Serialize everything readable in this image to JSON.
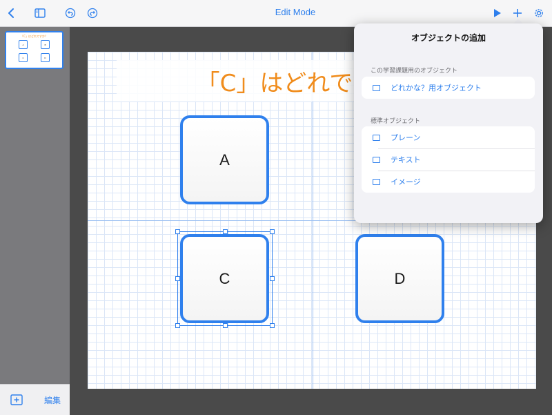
{
  "toolbar": {
    "title": "Edit Mode",
    "icons": [
      "chevron-left-icon",
      "sidebar-toggle-icon",
      "undo-icon",
      "redo-icon",
      "play-icon",
      "plus-icon",
      "gear-icon"
    ]
  },
  "sidebar": {
    "thumbnail": {
      "title": "「C」はどれですか？",
      "labels": [
        "A",
        "B",
        "C",
        "D"
      ]
    },
    "edit_label": "編集"
  },
  "canvas": {
    "title": "「C」はどれですか？",
    "cards": [
      {
        "label": "A"
      },
      {
        "label": "C"
      },
      {
        "label": "D"
      }
    ]
  },
  "popover": {
    "title": "オブジェクトの追加",
    "sections": [
      {
        "header": "この学習課題用のオブジェクト",
        "items": [
          {
            "label": "どれかな？用オブジェクト"
          }
        ]
      },
      {
        "header": "標準オブジェクト",
        "items": [
          {
            "label": "プレーン"
          },
          {
            "label": "テキスト"
          },
          {
            "label": "イメージ"
          }
        ]
      }
    ]
  },
  "colors": {
    "accent": "#2f80ed",
    "title_orange": "#f08c1c"
  }
}
